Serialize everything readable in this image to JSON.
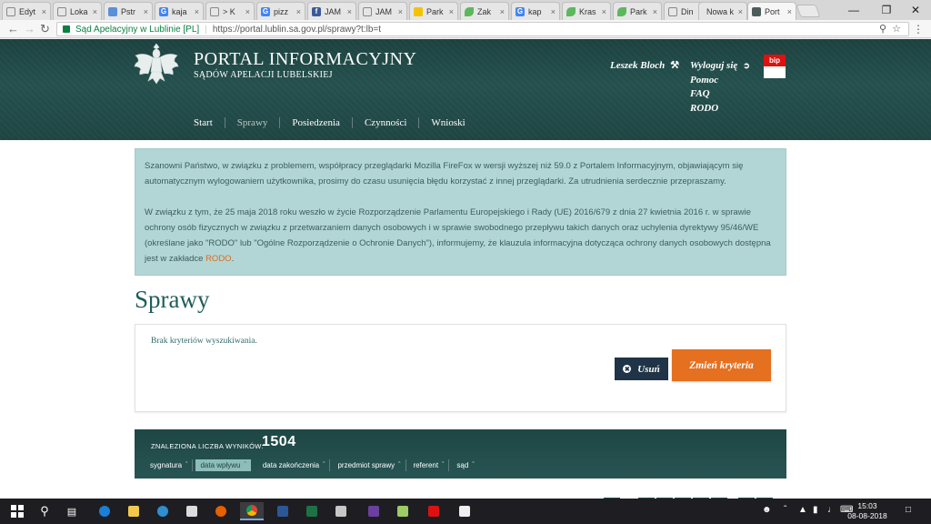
{
  "browser": {
    "tabs": [
      {
        "label": "Edyt",
        "icon": "page-icon",
        "color": "#888888"
      },
      {
        "label": "Loka",
        "icon": "page-icon",
        "color": "#888888"
      },
      {
        "label": "Pstr",
        "icon": "triangle-icon",
        "color": "#5b8fd8"
      },
      {
        "label": "kaja",
        "icon": "google-icon",
        "color": "#4285f4"
      },
      {
        "label": "> K",
        "icon": "page-icon",
        "color": "#888888"
      },
      {
        "label": "pizz",
        "icon": "google-icon",
        "color": "#4285f4"
      },
      {
        "label": "JAM",
        "icon": "facebook-icon",
        "color": "#3b5998"
      },
      {
        "label": "JAM",
        "icon": "page-icon",
        "color": "#888888"
      },
      {
        "label": "Park",
        "icon": "yellow-pin-icon",
        "color": "#f2c300"
      },
      {
        "label": "Zak",
        "icon": "leaf-icon",
        "color": "#5cb85c"
      },
      {
        "label": "kap",
        "icon": "google-icon",
        "color": "#4285f4"
      },
      {
        "label": "Kras",
        "icon": "leaf-icon",
        "color": "#5cb85c"
      },
      {
        "label": "Park",
        "icon": "leaf-icon",
        "color": "#5cb85c"
      },
      {
        "label": "Din",
        "icon": "page-icon",
        "color": "#888888"
      },
      {
        "label": "Nowa k",
        "icon": "none",
        "color": "#888888"
      },
      {
        "label": "Port",
        "icon": "eagle-icon",
        "color": "#4d5d5c",
        "active": true
      }
    ],
    "omnibox": {
      "secure_text": "Sąd Apelacyjny w Lublinie [PL]",
      "url": "https://portal.lublin.sa.gov.pl/sprawy?t:lb=t"
    }
  },
  "header": {
    "title": "PORTAL INFORMACYJNY",
    "subtitle": "SĄDÓW APELACJI LUBELSKIEJ",
    "nav": [
      "Start",
      "Sprawy",
      "Posiedzenia",
      "Czynności",
      "Wnioski"
    ],
    "user": "Leszek Bloch",
    "links": [
      "Wyloguj się",
      "Pomoc",
      "FAQ",
      "RODO"
    ],
    "bip_label": "bip"
  },
  "notice": {
    "p1": "Szanowni Państwo, w związku z problemem, współpracy przeglądarki Mozilla FireFox w wersji wyższej niż 59.0 z Portalem Informacyjnym, objawiającym się automatycznym wylogowaniem użytkownika, prosimy do czasu usunięcia błędu korzystać z innej przeglądarki. Za utrudnienia serdecznie przepraszamy.",
    "p2": "W związku z tym, że 25 maja 2018 roku weszło w życie Rozporządzenie Parlamentu Europejskiego i Rady (UE) 2016/679 z dnia 27 kwietnia 2016 r. w sprawie ochrony osób fizycznych w związku z przetwarzaniem danych osobowych i w sprawie swobodnego przepływu takich danych oraz uchylenia dyrektywy 95/46/WE (określane jako \"RODO\" lub \"Ogólne Rozporządzenie o Ochronie Danych\"), informujemy, że klauzula informacyjna dotycząca ochrony danych osobowych dostępna jest w zakładce ",
    "p2_link": "RODO",
    "p2_end": "."
  },
  "main": {
    "heading": "Sprawy",
    "criteria_msg": "Brak kryteriów wyszukiwania.",
    "remove_label": "Usuń",
    "change_label": "Zmień kryteria"
  },
  "results": {
    "label": "ZNALEZIONA LICZBA WYNIKÓW:",
    "count": "1504",
    "sort_columns": [
      {
        "label": "sygnatura",
        "active": false
      },
      {
        "label": "data wpływu",
        "active": true
      },
      {
        "label": "data zakończenia",
        "active": false
      },
      {
        "label": "przedmiot sprawy",
        "active": false
      },
      {
        "label": "referent",
        "active": false
      },
      {
        "label": "sąd",
        "active": false
      }
    ]
  },
  "taskbar": {
    "time": "15:03",
    "date": "08-08-2018"
  }
}
